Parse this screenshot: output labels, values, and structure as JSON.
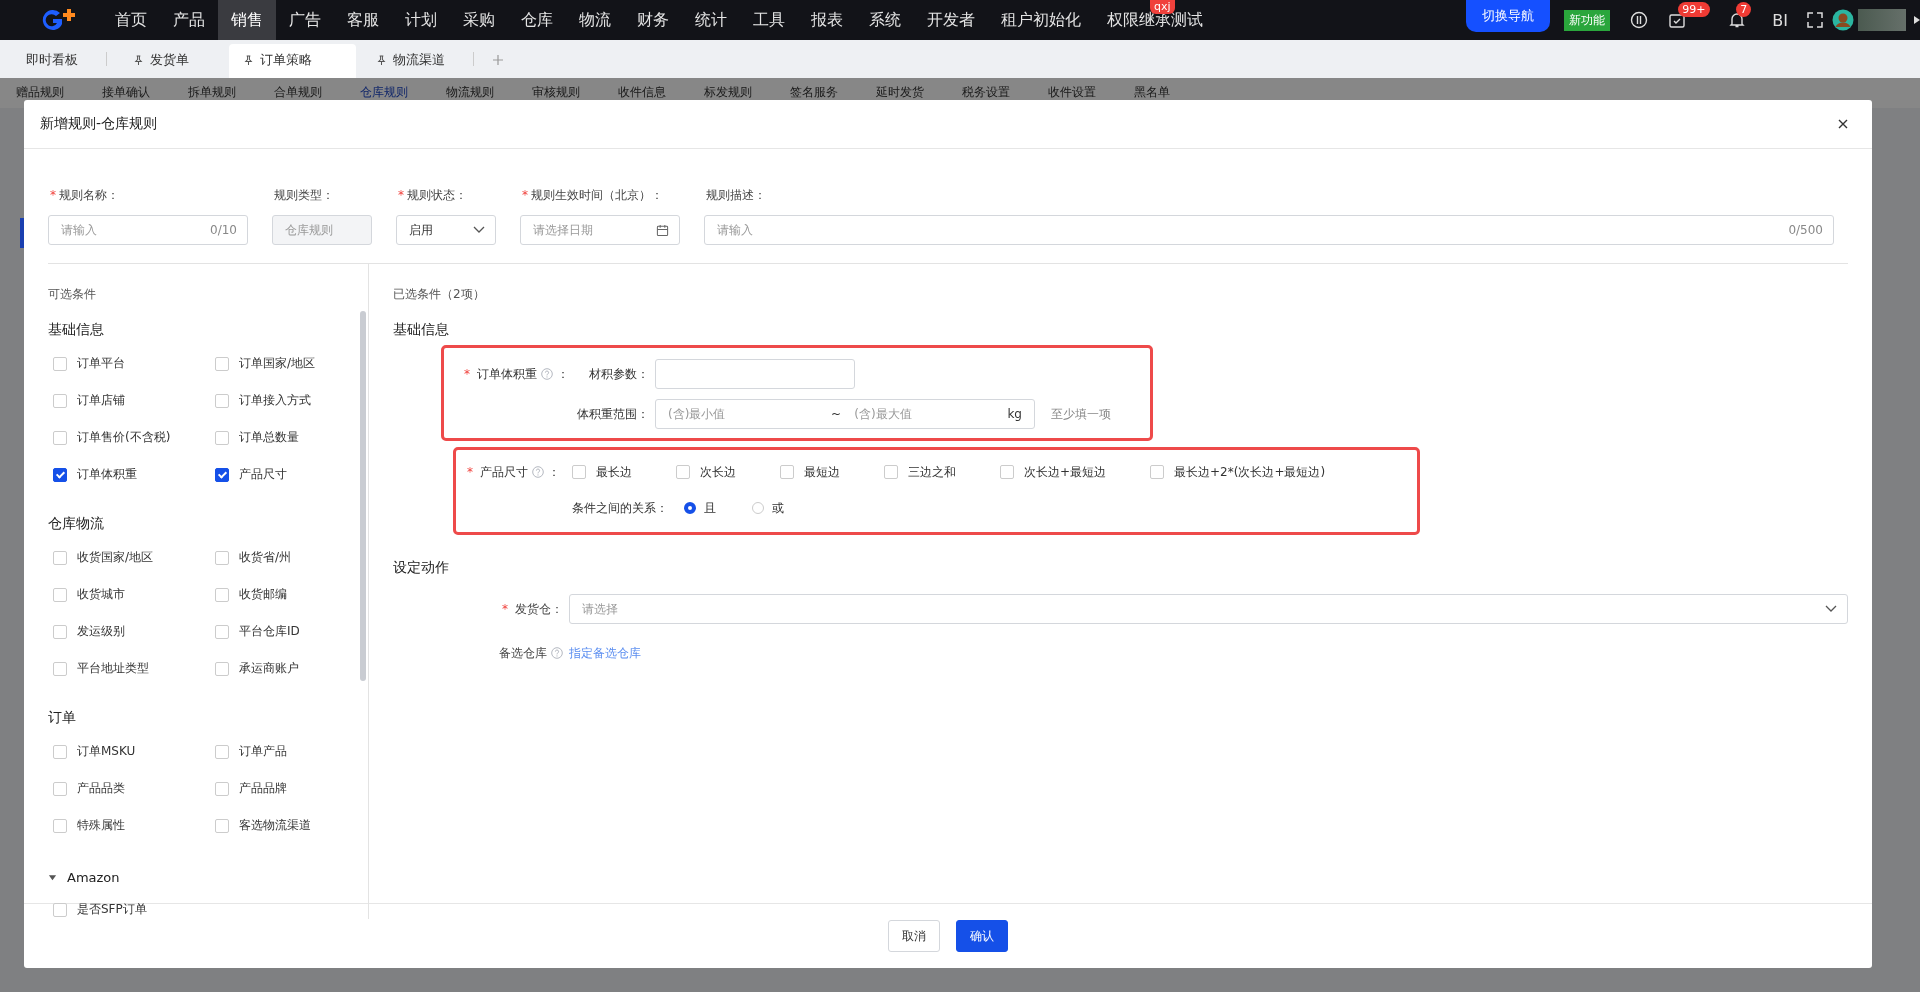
{
  "nav": {
    "items": [
      {
        "label": "首页",
        "selected": false
      },
      {
        "label": "产品",
        "selected": false
      },
      {
        "label": "销售",
        "selected": true
      },
      {
        "label": "广告",
        "selected": false
      },
      {
        "label": "客服",
        "selected": false
      },
      {
        "label": "计划",
        "selected": false
      },
      {
        "label": "采购",
        "selected": false
      },
      {
        "label": "仓库",
        "selected": false
      },
      {
        "label": "物流",
        "selected": false
      },
      {
        "label": "财务",
        "selected": false
      },
      {
        "label": "统计",
        "selected": false
      },
      {
        "label": "工具",
        "selected": false
      },
      {
        "label": "报表",
        "selected": false
      },
      {
        "label": "系统",
        "selected": false
      },
      {
        "label": "开发者",
        "selected": false
      },
      {
        "label": "租户初始化",
        "selected": false
      },
      {
        "label": "权限继承测试",
        "selected": false,
        "badge": "qxj"
      }
    ],
    "switch_button": "切换导航",
    "new_feature": "新功能",
    "tasks_badge": "99+",
    "bell_badge": "7",
    "bi": "BI"
  },
  "tabs": [
    {
      "label": "即时看板",
      "selected": false,
      "pinned": false
    },
    {
      "label": "发货单",
      "selected": false,
      "pinned": true
    },
    {
      "label": "订单策略",
      "selected": true,
      "pinned": true
    },
    {
      "label": "物流渠道",
      "selected": false,
      "pinned": true
    }
  ],
  "sub_tabs": [
    {
      "label": "赠品规则",
      "selected": false
    },
    {
      "label": "接单确认",
      "selected": false
    },
    {
      "label": "拆单规则",
      "selected": false
    },
    {
      "label": "合单规则",
      "selected": false
    },
    {
      "label": "仓库规则",
      "selected": true
    },
    {
      "label": "物流规则",
      "selected": false
    },
    {
      "label": "审核规则",
      "selected": false
    },
    {
      "label": "收件信息",
      "selected": false
    },
    {
      "label": "标发规则",
      "selected": false
    },
    {
      "label": "签名服务",
      "selected": false
    },
    {
      "label": "延时发货",
      "selected": false
    },
    {
      "label": "税务设置",
      "selected": false
    },
    {
      "label": "收件设置",
      "selected": false
    },
    {
      "label": "黑名单",
      "selected": false
    }
  ],
  "dialog": {
    "title": "新增规则-仓库规则",
    "fields": [
      {
        "kind": "text",
        "label": "规则名称：",
        "required_mark": "*",
        "placeholder": "请输入",
        "count": "0/10"
      },
      {
        "kind": "readonly",
        "label": "规则类型：",
        "value": "仓库规则"
      },
      {
        "kind": "select",
        "label": "规则状态：",
        "required_mark": "*",
        "value": "启用"
      },
      {
        "kind": "date",
        "label": "规则生效时间（北京）：",
        "required_mark": "*",
        "placeholder": "请选择日期"
      },
      {
        "kind": "text",
        "label": "规则描述：",
        "placeholder": "请输入",
        "count": "0/500"
      }
    ],
    "available": {
      "title": "可选条件",
      "groups": [
        {
          "title": "基础信息",
          "kind": "plain",
          "items": [
            {
              "label": "订单平台",
              "checked": false
            },
            {
              "label": "订单国家/地区",
              "checked": false
            },
            {
              "label": "订单店铺",
              "checked": false
            },
            {
              "label": "订单接入方式",
              "checked": false
            },
            {
              "label": "订单售价(不含税)",
              "checked": false
            },
            {
              "label": "订单总数量",
              "checked": false
            },
            {
              "label": "订单体积重",
              "checked": true
            },
            {
              "label": "产品尺寸",
              "checked": true
            }
          ]
        },
        {
          "title": "仓库物流",
          "kind": "plain",
          "items": [
            {
              "label": "收货国家/地区",
              "checked": false
            },
            {
              "label": "收货省/州",
              "checked": false
            },
            {
              "label": "收货城市",
              "checked": false
            },
            {
              "label": "收货邮编",
              "checked": false
            },
            {
              "label": "发运级别",
              "checked": false
            },
            {
              "label": "平台仓库ID",
              "checked": false
            },
            {
              "label": "平台地址类型",
              "checked": false
            },
            {
              "label": "承运商账户",
              "checked": false
            }
          ]
        },
        {
          "title": "订单",
          "kind": "plain",
          "items": [
            {
              "label": "订单MSKU",
              "checked": false
            },
            {
              "label": "订单产品",
              "checked": false
            },
            {
              "label": "产品品类",
              "checked": false
            },
            {
              "label": "产品品牌",
              "checked": false
            },
            {
              "label": "特殊属性",
              "checked": false
            },
            {
              "label": "客选物流渠道",
              "checked": false
            }
          ]
        },
        {
          "title": "Amazon",
          "kind": "collapsible",
          "expanded": true,
          "items": [
            {
              "label": "是否SFP订单",
              "checked": false
            }
          ]
        }
      ]
    },
    "selected": {
      "title": "已选条件（2项）",
      "section": "基础信息",
      "conditions": [
        {
          "kind": "volume",
          "label": "订单体积重",
          "colon": "：",
          "required_mark": "*",
          "highlighted": true,
          "param_label": "材积参数：",
          "range_label": "体积重范围：",
          "min_placeholder": "(含)最小值",
          "separator": "~",
          "max_placeholder": "(含)最大值",
          "unit": "kg",
          "hint": "至少填一项"
        },
        {
          "kind": "size",
          "label": "产品尺寸",
          "colon": "：",
          "required_mark": "*",
          "highlighted": true,
          "options": [
            {
              "label": "最长边",
              "checked": false
            },
            {
              "label": "次长边",
              "checked": false
            },
            {
              "label": "最短边",
              "checked": false
            },
            {
              "label": "三边之和",
              "checked": false
            },
            {
              "label": "次长边+最短边",
              "checked": false
            },
            {
              "label": "最长边+2*(次长边+最短边)",
              "checked": false
            }
          ],
          "relation_label": "条件之间的关系：",
          "relations": [
            {
              "label": "且",
              "selected": true
            },
            {
              "label": "或",
              "selected": false
            }
          ]
        }
      ]
    },
    "action": {
      "title": "设定动作",
      "warehouse_label": "发货仓：",
      "warehouse_required_mark": "*",
      "warehouse_placeholder": "请选择",
      "backup_label": "备选仓库",
      "backup_link": "指定备选仓库"
    },
    "buttons": [
      {
        "label": "取消",
        "kind": "default"
      },
      {
        "label": "确认",
        "kind": "primary"
      }
    ]
  }
}
